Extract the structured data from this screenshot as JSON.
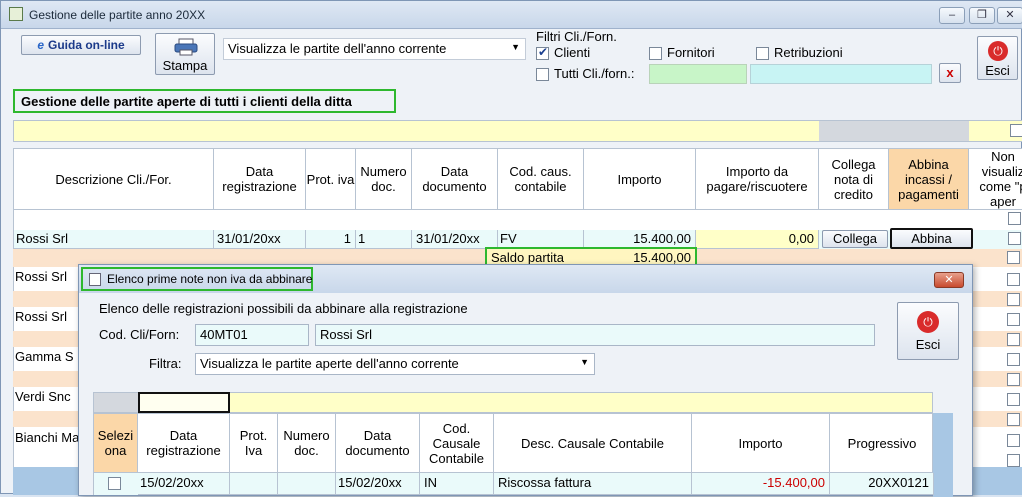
{
  "window": {
    "title": "Gestione delle partite anno 20XX",
    "controls": [
      "‒",
      "❐",
      "✕"
    ]
  },
  "toolbar": {
    "guida_label": "Guida on-line",
    "stampa_label": "Stampa",
    "view_select": "Visualizza le partite dell'anno corrente",
    "esci_label": "Esci"
  },
  "filters": {
    "title": "Filtri Cli./Forn.",
    "clienti": "Clienti",
    "clienti_checked": true,
    "fornitori": "Fornitori",
    "retribuzioni": "Retribuzioni",
    "tutti": "Tutti Cli./forn.:",
    "clear_button": "x"
  },
  "heading": "Gestione delle partite aperte di tutti i clienti della ditta",
  "main_grid": {
    "headers": [
      "Descrizione Cli./For.",
      "Data registrazione",
      "Prot. iva",
      "Numero doc.",
      "Data documento",
      "Cod. caus. contabile",
      "Importo",
      "Importo da pagare/riscuotere",
      "Collega nota di credito",
      "Abbina incassi / pagamenti",
      "Non visualiz come \"p aper"
    ],
    "row1": {
      "descrizione": "Rossi Srl",
      "data_registrazione": "31/01/20xx",
      "prot_iva": "1",
      "numero_doc": "1",
      "data_documento": "31/01/20xx",
      "causale": "FV",
      "importo": "15.400,00",
      "da_pagare": "0,00",
      "collega_button": "Collega",
      "abbina_button": "Abbina"
    },
    "saldo_label": "Saldo partita",
    "saldo_value": "15.400,00",
    "other_rows": [
      "Rossi Srl",
      "Rossi Srl",
      "Gamma S",
      "Verdi Snc",
      "Bianchi Ma"
    ]
  },
  "dialog": {
    "title": "Elenco prime note non iva da abbinare",
    "subtitle": "Elenco delle registrazioni possibili da abbinare alla registrazione",
    "cod_label": "Cod. Cli/Forn:",
    "cod_value": "40MT01",
    "name_value": "Rossi Srl",
    "filtra_label": "Filtra:",
    "filtra_value": "Visualizza le partite aperte dell'anno corrente",
    "esci_label": "Esci",
    "headers": [
      "Selezi ona",
      "Data registrazione",
      "Prot. Iva",
      "Numero doc.",
      "Data documento",
      "Cod. Causale Contabile",
      "Desc. Causale Contabile",
      "Importo",
      "Progressivo"
    ],
    "row": {
      "data_registrazione": "15/02/20xx",
      "data_documento": "15/02/20xx",
      "causale": "IN",
      "descrizione": "Riscossa fattura",
      "importo": "-15.400,00",
      "progressivo": "20XX0121"
    }
  },
  "colors": {
    "highlight": "#2eb82e",
    "grid_yellow": "#ffffc8",
    "negative": "#cc0000"
  }
}
